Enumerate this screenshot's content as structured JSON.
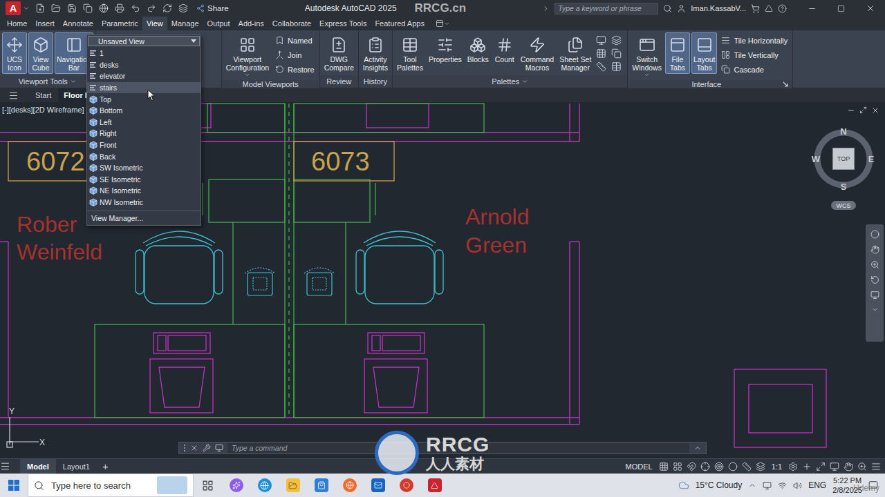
{
  "title_bar": {
    "logo": "A",
    "title": "Autodesk AutoCAD 2025",
    "share": "Share",
    "search_placeholder": "Type a keyword or phrase",
    "user": "Iman.KassabV...",
    "watermark": "RRCG.cn"
  },
  "ribbon_tabs": [
    {
      "label": "Home",
      "selected": false
    },
    {
      "label": "Insert",
      "selected": false
    },
    {
      "label": "Annotate",
      "selected": false
    },
    {
      "label": "Parametric",
      "selected": false
    },
    {
      "label": "View",
      "selected": true
    },
    {
      "label": "Manage",
      "selected": false
    },
    {
      "label": "Output",
      "selected": false
    },
    {
      "label": "Add-ins",
      "selected": false
    },
    {
      "label": "Collaborate",
      "selected": false
    },
    {
      "label": "Express Tools",
      "selected": false
    },
    {
      "label": "Featured Apps",
      "selected": false
    }
  ],
  "ribbon_panels": [
    {
      "title": "Viewport Tools",
      "menu": true,
      "launcher": false,
      "large": [
        {
          "lines": [
            "UCS",
            "Icon"
          ],
          "selected": true,
          "menu": false
        },
        {
          "lines": [
            "View",
            "Cube"
          ],
          "selected": true,
          "menu": false
        },
        {
          "lines": [
            "Navigation",
            "Bar"
          ],
          "selected": true,
          "menu": false
        }
      ],
      "small": []
    },
    {
      "title": "Model Viewports",
      "menu": false,
      "launcher": false,
      "large": [
        {
          "lines": [
            "Viewport",
            "Configuration"
          ],
          "selected": false,
          "menu": true
        }
      ],
      "small": [
        "Named",
        "Join",
        "Restore"
      ]
    },
    {
      "title": "Review",
      "menu": false,
      "launcher": false,
      "large": [
        {
          "lines": [
            "DWG",
            "Compare"
          ],
          "selected": false,
          "menu": false
        }
      ],
      "small": []
    },
    {
      "title": "History",
      "menu": false,
      "launcher": false,
      "large": [
        {
          "lines": [
            "Activity",
            "Insights"
          ],
          "selected": false,
          "menu": false
        }
      ],
      "small": []
    },
    {
      "title": "Palettes",
      "menu": true,
      "launcher": false,
      "large": [
        {
          "lines": [
            "Tool",
            "Palettes"
          ],
          "selected": false,
          "menu": false
        },
        {
          "lines": [
            "Properties"
          ],
          "selected": false,
          "menu": false
        },
        {
          "lines": [
            "Blocks"
          ],
          "selected": false,
          "menu": false
        },
        {
          "lines": [
            "Count"
          ],
          "selected": false,
          "menu": false
        },
        {
          "lines": [
            "Command",
            "Macros"
          ],
          "selected": false,
          "menu": false
        },
        {
          "lines": [
            "Sheet Set",
            "Manager"
          ],
          "selected": false,
          "menu": false
        }
      ],
      "small": []
    },
    {
      "title": "Interface",
      "menu": false,
      "launcher": true,
      "large": [
        {
          "lines": [
            "Switch",
            "Windows"
          ],
          "selected": false,
          "menu": true
        },
        {
          "lines": [
            "File",
            "Tabs"
          ],
          "selected": true,
          "menu": false
        },
        {
          "lines": [
            "Layout",
            "Tabs"
          ],
          "selected": true,
          "menu": false
        }
      ],
      "small": [
        "Tile Horizontally",
        "Tile Vertically",
        "Cascade"
      ]
    }
  ],
  "file_tabs": [
    {
      "label": "Start",
      "selected": false
    },
    {
      "label": "Floor Pl",
      "selected": true
    }
  ],
  "view_menu": {
    "current": "Unsaved View",
    "items": [
      {
        "label": "1",
        "kind": "named",
        "selected": false
      },
      {
        "label": "desks",
        "kind": "named",
        "selected": false
      },
      {
        "label": "elevator",
        "kind": "named",
        "selected": false
      },
      {
        "label": "stairs",
        "kind": "named",
        "selected": true
      },
      {
        "label": "Top",
        "kind": "preset",
        "selected": false
      },
      {
        "label": "Bottom",
        "kind": "preset",
        "selected": false
      },
      {
        "label": "Left",
        "kind": "preset",
        "selected": false
      },
      {
        "label": "Right",
        "kind": "preset",
        "selected": false
      },
      {
        "label": "Front",
        "kind": "preset",
        "selected": false
      },
      {
        "label": "Back",
        "kind": "preset",
        "selected": false
      },
      {
        "label": "SW Isometric",
        "kind": "preset",
        "selected": false
      },
      {
        "label": "SE Isometric",
        "kind": "preset",
        "selected": false
      },
      {
        "label": "NE Isometric",
        "kind": "preset",
        "selected": false
      },
      {
        "label": "NW Isometric",
        "kind": "preset",
        "selected": false
      }
    ],
    "footer": "View Manager..."
  },
  "viewport": {
    "label": "[-][desks][2D Wireframe]"
  },
  "drawing": {
    "labels": [
      {
        "text": "6072",
        "color": "#c9a24a"
      },
      {
        "text": "6073",
        "color": "#c9a24a"
      },
      {
        "text": "Rober",
        "color": "#a8302f"
      },
      {
        "text": "Weinfeld",
        "color": "#a8302f"
      },
      {
        "text": "Arnold",
        "color": "#a8302f"
      },
      {
        "text": "Green",
        "color": "#a8302f"
      }
    ],
    "ucs": {
      "x": "X",
      "y": "Y"
    }
  },
  "view_cube": {
    "face": "TOP",
    "north": "N",
    "south": "S",
    "west": "W",
    "east": "E",
    "coord": "WCS"
  },
  "command_line": {
    "placeholder": "Type a command"
  },
  "layout_tabs": [
    {
      "label": "Model",
      "selected": true
    },
    {
      "label": "Layout1",
      "selected": false
    }
  ],
  "add_tab": "+",
  "status_bar": {
    "space": "MODEL",
    "scale": "1:1"
  },
  "taskbar": {
    "search_placeholder": "Type here to search",
    "weather": "15°C Cloudy",
    "language": "ENG",
    "time": "5:22 PM",
    "date": "2/8/2025"
  },
  "watermarks": {
    "logo": "RRCG",
    "subtitle": "人人素材",
    "corner": "Udemy"
  }
}
